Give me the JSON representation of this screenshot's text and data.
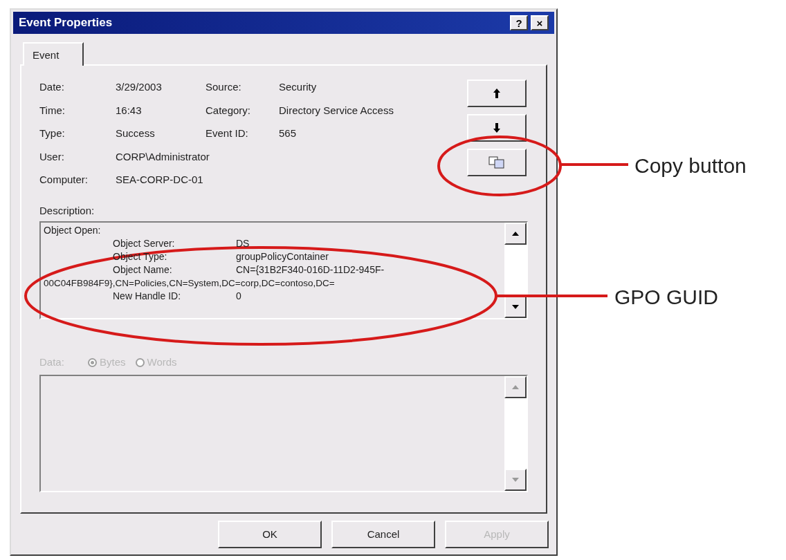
{
  "window": {
    "title": "Event Properties",
    "title_buttons": [
      {
        "label": "?"
      },
      {
        "label": "×"
      }
    ]
  },
  "tabs": [
    {
      "label": "Event",
      "selected": true
    }
  ],
  "details_left": [
    {
      "label": "Date:",
      "value": "3/29/2003"
    },
    {
      "label": "Time:",
      "value": "16:43"
    },
    {
      "label": "Type:",
      "value": "Success"
    },
    {
      "label": "User:",
      "value": "CORP\\Administrator"
    },
    {
      "label": "Computer:",
      "value": "SEA-CORP-DC-01"
    }
  ],
  "details_right": [
    {
      "label": "Source:",
      "value": "Security"
    },
    {
      "label": "Category:",
      "value": "Directory Service Access"
    },
    {
      "label": "Event ID:",
      "value": "565"
    }
  ],
  "side_buttons": [
    {
      "kind": "up"
    },
    {
      "kind": "down"
    },
    {
      "kind": "copy"
    }
  ],
  "description": {
    "label": "Description:",
    "lines": [
      {
        "kind": "heading",
        "text": "Object Open:"
      },
      {
        "kind": "field",
        "label": "Object Server:",
        "value": "DS"
      },
      {
        "kind": "field",
        "label": "Object Type:",
        "value": "groupPolicyContainer"
      },
      {
        "kind": "field",
        "label": "Object Name:",
        "value": "CN={31B2F340-016D-11D2-945F-"
      },
      {
        "kind": "wrap",
        "text": "00C04FB984F9},CN=Policies,CN=System,DC=corp,DC=contoso,DC="
      },
      {
        "kind": "field",
        "label": "New Handle ID:",
        "value": "0"
      }
    ]
  },
  "data": {
    "label": "Data:",
    "disabled": true,
    "options": [
      {
        "label": "Bytes",
        "selected": true
      },
      {
        "label": "Words",
        "selected": false
      }
    ]
  },
  "buttons": [
    {
      "label": "OK",
      "disabled": false
    },
    {
      "label": "Cancel",
      "disabled": false
    },
    {
      "label": "Apply",
      "disabled": true
    }
  ],
  "annotations": [
    {
      "label": "Copy button"
    },
    {
      "label": "GPO GUID"
    }
  ]
}
